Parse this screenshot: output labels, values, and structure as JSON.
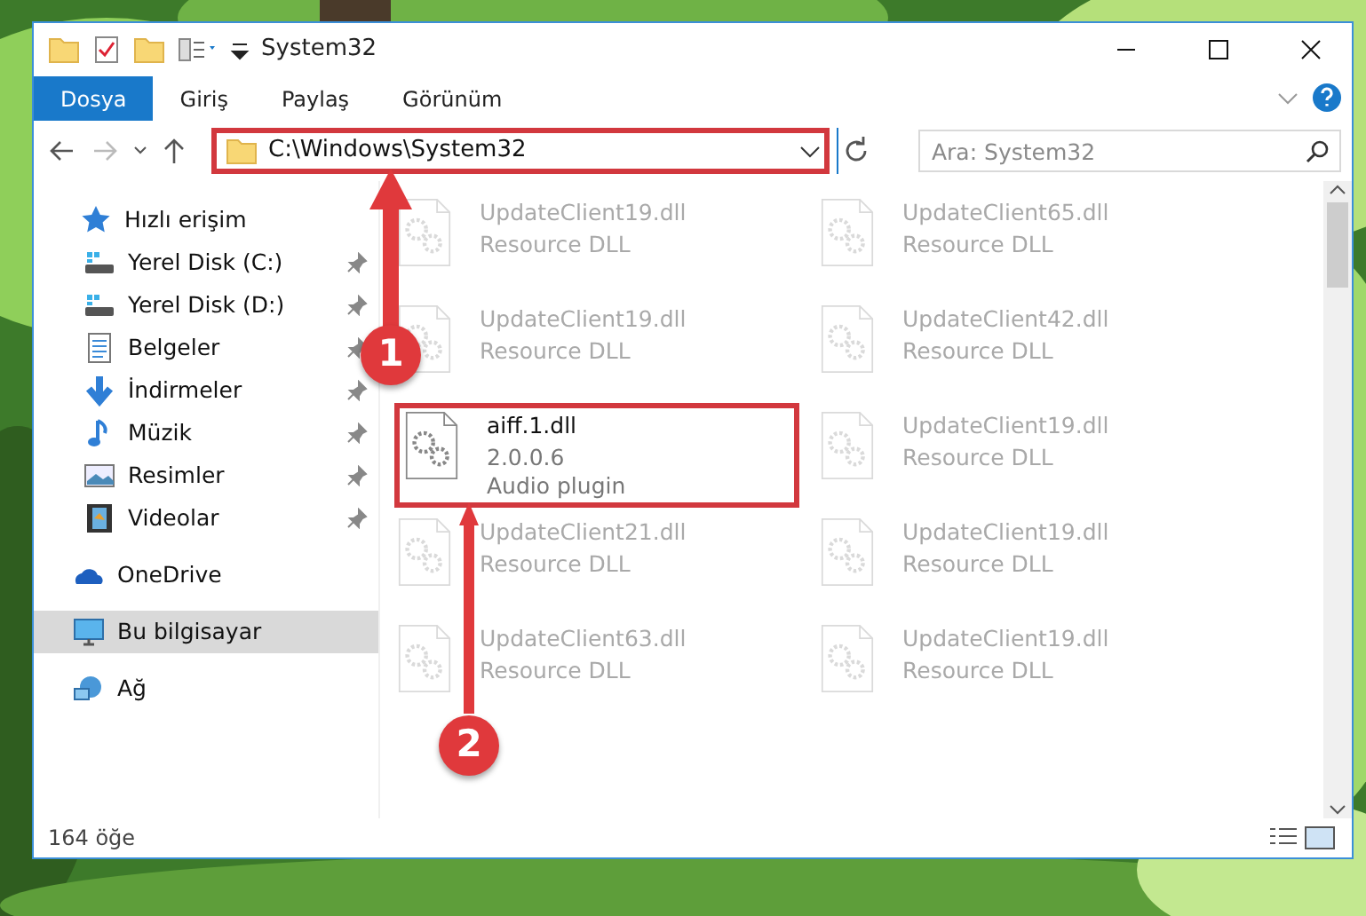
{
  "window": {
    "title": "System32"
  },
  "ribbon_tabs": [
    {
      "label": "Dosya",
      "selected": true
    },
    {
      "label": "Giriş",
      "selected": false
    },
    {
      "label": "Paylaş",
      "selected": false
    },
    {
      "label": "Görünüm",
      "selected": false
    }
  ],
  "address": {
    "path": "C:\\Windows\\System32",
    "highlighted": true
  },
  "search": {
    "placeholder": "Ara: System32"
  },
  "sidebar": {
    "items": [
      {
        "label": "Hızlı erişim",
        "kind": "star",
        "selected": false,
        "children": [
          {
            "label": "Yerel Disk (C:)",
            "kind": "disk",
            "pinned": true,
            "selected": false
          },
          {
            "label": "Yerel Disk (D:)",
            "kind": "disk",
            "pinned": true,
            "selected": false
          },
          {
            "label": "Belgeler",
            "kind": "documents",
            "pinned": true,
            "selected": false
          },
          {
            "label": "İndirmeler",
            "kind": "downloads",
            "pinned": true,
            "selected": false
          },
          {
            "label": "Müzik",
            "kind": "music",
            "pinned": true,
            "selected": false
          },
          {
            "label": "Resimler",
            "kind": "pictures",
            "pinned": true,
            "selected": false
          },
          {
            "label": "Videolar",
            "kind": "videos",
            "pinned": true,
            "selected": false
          }
        ]
      },
      {
        "label": "OneDrive",
        "kind": "cloud",
        "selected": false
      },
      {
        "label": "Bu bilgisayar",
        "kind": "computer",
        "selected": true
      },
      {
        "label": "Ağ",
        "kind": "network",
        "selected": false
      }
    ]
  },
  "files": [
    {
      "name": "UpdateClient19.dll",
      "details": [
        "Resource DLL"
      ],
      "faded": true,
      "highlighted": false
    },
    {
      "name": "UpdateClient65.dll",
      "details": [
        "Resource DLL"
      ],
      "faded": true,
      "highlighted": false
    },
    {
      "name": "UpdateClient19.dll",
      "details": [
        "Resource DLL"
      ],
      "faded": true,
      "highlighted": false
    },
    {
      "name": "UpdateClient42.dll",
      "details": [
        "Resource DLL"
      ],
      "faded": true,
      "highlighted": false
    },
    {
      "name": "aiff.1.dll",
      "details": [
        "2.0.0.6",
        "Audio plugin"
      ],
      "faded": false,
      "highlighted": true
    },
    {
      "name": "UpdateClient19.dll",
      "details": [
        "Resource DLL"
      ],
      "faded": true,
      "highlighted": false
    },
    {
      "name": "UpdateClient21.dll",
      "details": [
        "Resource DLL"
      ],
      "faded": true,
      "highlighted": false
    },
    {
      "name": "UpdateClient19.dll",
      "details": [
        "Resource DLL"
      ],
      "faded": true,
      "highlighted": false
    },
    {
      "name": "UpdateClient63.dll",
      "details": [
        "Resource DLL"
      ],
      "faded": true,
      "highlighted": false
    },
    {
      "name": "UpdateClient19.dll",
      "details": [
        "Resource DLL"
      ],
      "faded": true,
      "highlighted": false
    }
  ],
  "status_bar": {
    "item_count": "164 öğe"
  },
  "annotations": [
    {
      "number": "1"
    },
    {
      "number": "2"
    }
  ]
}
